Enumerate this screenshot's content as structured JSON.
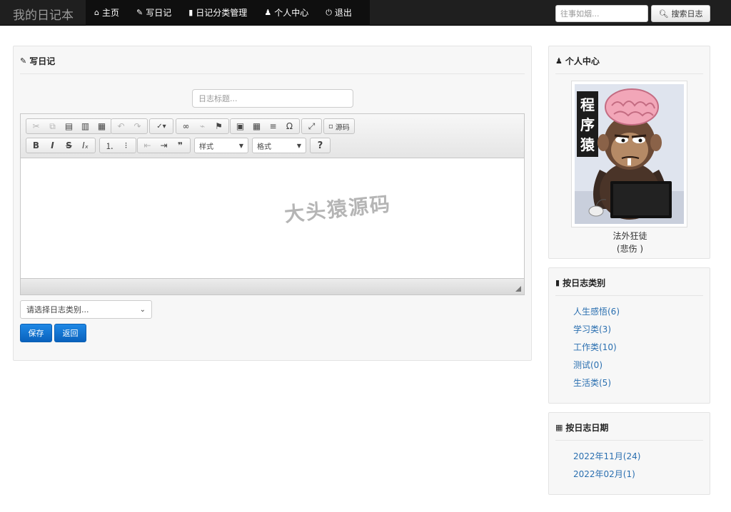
{
  "navbar": {
    "brand": "我的日记本",
    "items": [
      {
        "label": "主页",
        "icon": "home-icon"
      },
      {
        "label": "写日记",
        "icon": "pencil-icon"
      },
      {
        "label": "日记分类管理",
        "icon": "book-icon"
      },
      {
        "label": "个人中心",
        "icon": "user-icon"
      },
      {
        "label": "退出",
        "icon": "power-icon"
      }
    ],
    "search_placeholder": "往事如烟...",
    "search_button": "搜索日志"
  },
  "write": {
    "title": "写日记",
    "title_placeholder": "日志标题...",
    "toolbar": {
      "source_label": "源码",
      "style_combo": "样式",
      "format_combo": "格式",
      "help": "?"
    },
    "category_placeholder": "请选择日志类别...",
    "save_label": "保存",
    "back_label": "返回"
  },
  "watermark": "大头猿源码",
  "profile": {
    "title": "个人中心",
    "avatar_text": "程序猿",
    "name": "法外狂徒",
    "mood": "(悲伤 )"
  },
  "categories": {
    "title": "按日志类别",
    "items": [
      "人生感悟(6)",
      "学习类(3)",
      "工作类(10)",
      "测试(0)",
      "生活类(5)"
    ]
  },
  "dates": {
    "title": "按日志日期",
    "items": [
      "2022年11月(24)",
      "2022年02月(1)"
    ]
  }
}
